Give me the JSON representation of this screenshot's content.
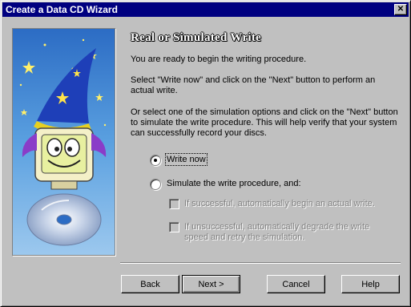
{
  "window": {
    "title": "Create a Data CD Wizard",
    "close_glyph": "✕"
  },
  "heading": "Real or Simulated Write",
  "paragraphs": {
    "p1": "You are ready to begin the writing procedure.",
    "p2": "Select \"Write now\" and click on the \"Next\" button to perform an actual write.",
    "p3": "Or select one of the simulation options and click on the \"Next\" button to simulate the write procedure.  This will help verify that your system can successfully record your discs."
  },
  "options": {
    "write_now": {
      "label": "Write now",
      "selected": true
    },
    "simulate": {
      "label": "Simulate the write procedure, and:",
      "selected": false
    },
    "check_success": {
      "label": "If successful, automatically begin an actual write.",
      "checked": false,
      "disabled": true
    },
    "check_fail": {
      "label": "If unsuccessful, automatically degrade the write speed and retry the simulation.",
      "checked": false,
      "disabled": true
    }
  },
  "buttons": {
    "back": "Back",
    "next": "Next >",
    "cancel": "Cancel",
    "help": "Help"
  },
  "colors": {
    "titlebar": "#000080",
    "panel_bg": "#c0c0c0",
    "illustration_sky": "#3a7fd0",
    "hat": "#1e3fb8"
  }
}
